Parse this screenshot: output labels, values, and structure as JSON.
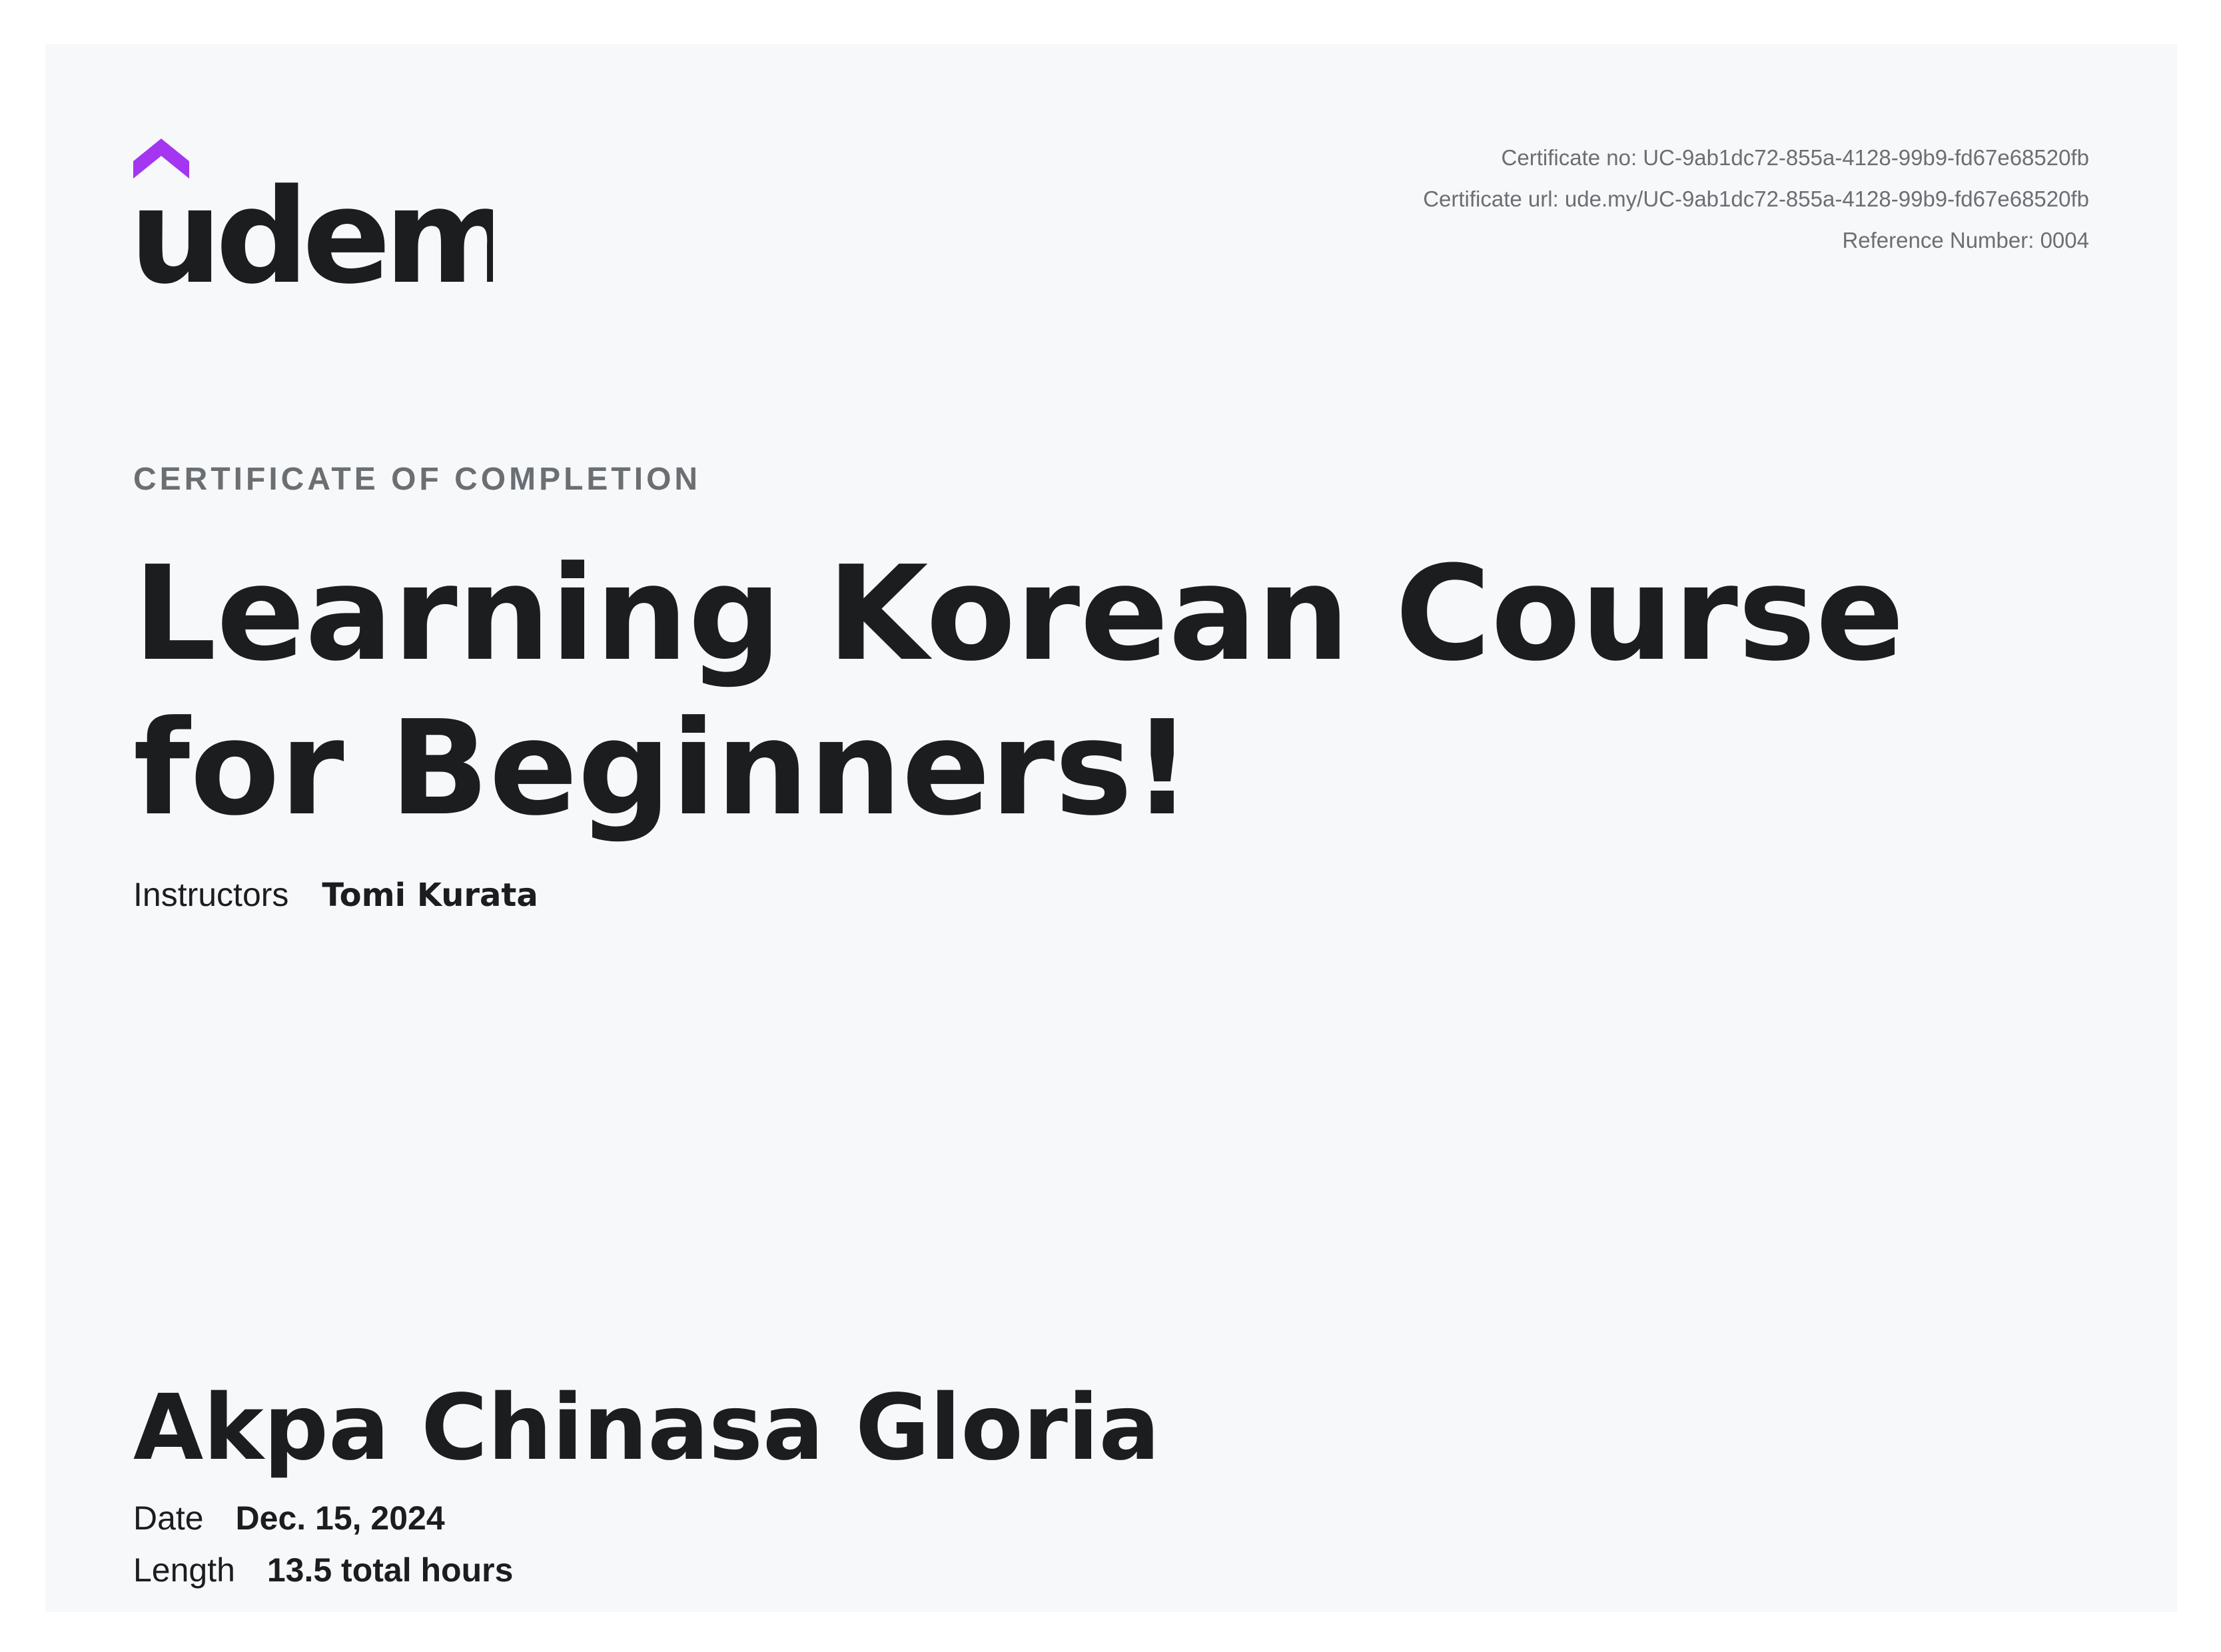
{
  "logo": {
    "text": "udemy",
    "accent_color": "#a435f0",
    "text_color": "#1c1d1f"
  },
  "certificate_meta": {
    "number_line": "Certificate no: UC-9ab1dc72-855a-4128-99b9-fd67e68520fb",
    "url_line": "Certificate url: ude.my/UC-9ab1dc72-855a-4128-99b9-fd67e68520fb",
    "reference_line": "Reference Number: 0004"
  },
  "heading": "CERTIFICATE OF COMPLETION",
  "course": {
    "title": "Learning Korean Course for Beginners!"
  },
  "instructors": {
    "label": "Instructors",
    "value": "Tomi Kurata"
  },
  "recipient": {
    "name": "Akpa Chinasa Gloria"
  },
  "details": {
    "date_label": "Date",
    "date_value": "Dec. 15, 2024",
    "length_label": "Length",
    "length_value": "13.5 total hours"
  },
  "colors": {
    "background": "#f7f8fa",
    "text_primary": "#1c1d1f",
    "text_secondary": "#6a6f73"
  }
}
